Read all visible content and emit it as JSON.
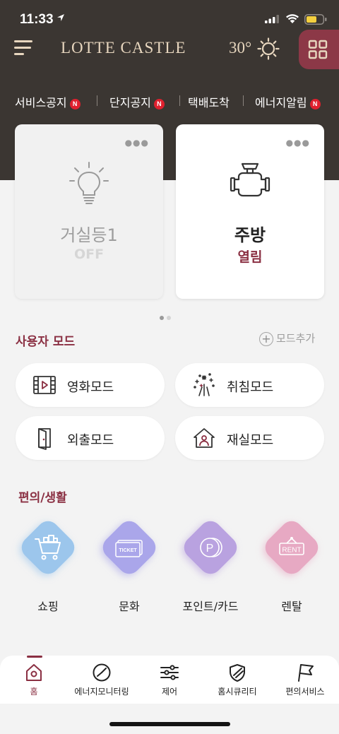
{
  "status_bar": {
    "time": "11:33"
  },
  "header": {
    "title": "LOTTE CASTLE",
    "temperature": "30°"
  },
  "notices": [
    {
      "label": "서비스공지",
      "badge": "N"
    },
    {
      "label": "단지공지",
      "badge": "N"
    },
    {
      "label": "택배도착",
      "badge": ""
    },
    {
      "label": "에너지알림",
      "badge": "N"
    }
  ],
  "devices": [
    {
      "name": "거실등1",
      "state": "OFF",
      "icon": "light-bulb-icon"
    },
    {
      "name": "주방",
      "state": "열림",
      "icon": "gas-valve-icon"
    }
  ],
  "pager": {
    "total": 2,
    "active": 1
  },
  "user_mode": {
    "title": "사용자 모드",
    "add_label": "모드추가",
    "modes": [
      {
        "label": "영화모드",
        "icon": "film-icon"
      },
      {
        "label": "취침모드",
        "icon": "fireworks-icon"
      },
      {
        "label": "외출모드",
        "icon": "door-icon"
      },
      {
        "label": "재실모드",
        "icon": "home-person-icon"
      }
    ]
  },
  "services": {
    "title": "편의/생활",
    "items": [
      {
        "label": "쇼핑",
        "icon": "shopping-cart-icon",
        "color": "#9cc6ec",
        "icon_text": ""
      },
      {
        "label": "문화",
        "icon": "ticket-icon",
        "color": "#aaa6ea",
        "icon_text": "TICKET"
      },
      {
        "label": "포인트/카드",
        "icon": "point-coin-icon",
        "color": "#b9a2e0",
        "icon_text": "P"
      },
      {
        "label": "렌탈",
        "icon": "rent-sign-icon",
        "color": "#e7a9c3",
        "icon_text": "RENT"
      }
    ]
  },
  "bottom_nav": [
    {
      "label": "홈",
      "icon": "home-icon",
      "active": true
    },
    {
      "label": "에너지모니터링",
      "icon": "gauge-icon",
      "active": false
    },
    {
      "label": "제어",
      "icon": "sliders-icon",
      "active": false
    },
    {
      "label": "홈시큐리티",
      "icon": "shield-icon",
      "active": false
    },
    {
      "label": "편의서비스",
      "icon": "flag-icon",
      "active": false
    }
  ],
  "colors": {
    "header_bg": "#3b3632",
    "accent": "#8a2f42",
    "grid_button": "#8c3847",
    "badge": "#e0202e"
  }
}
